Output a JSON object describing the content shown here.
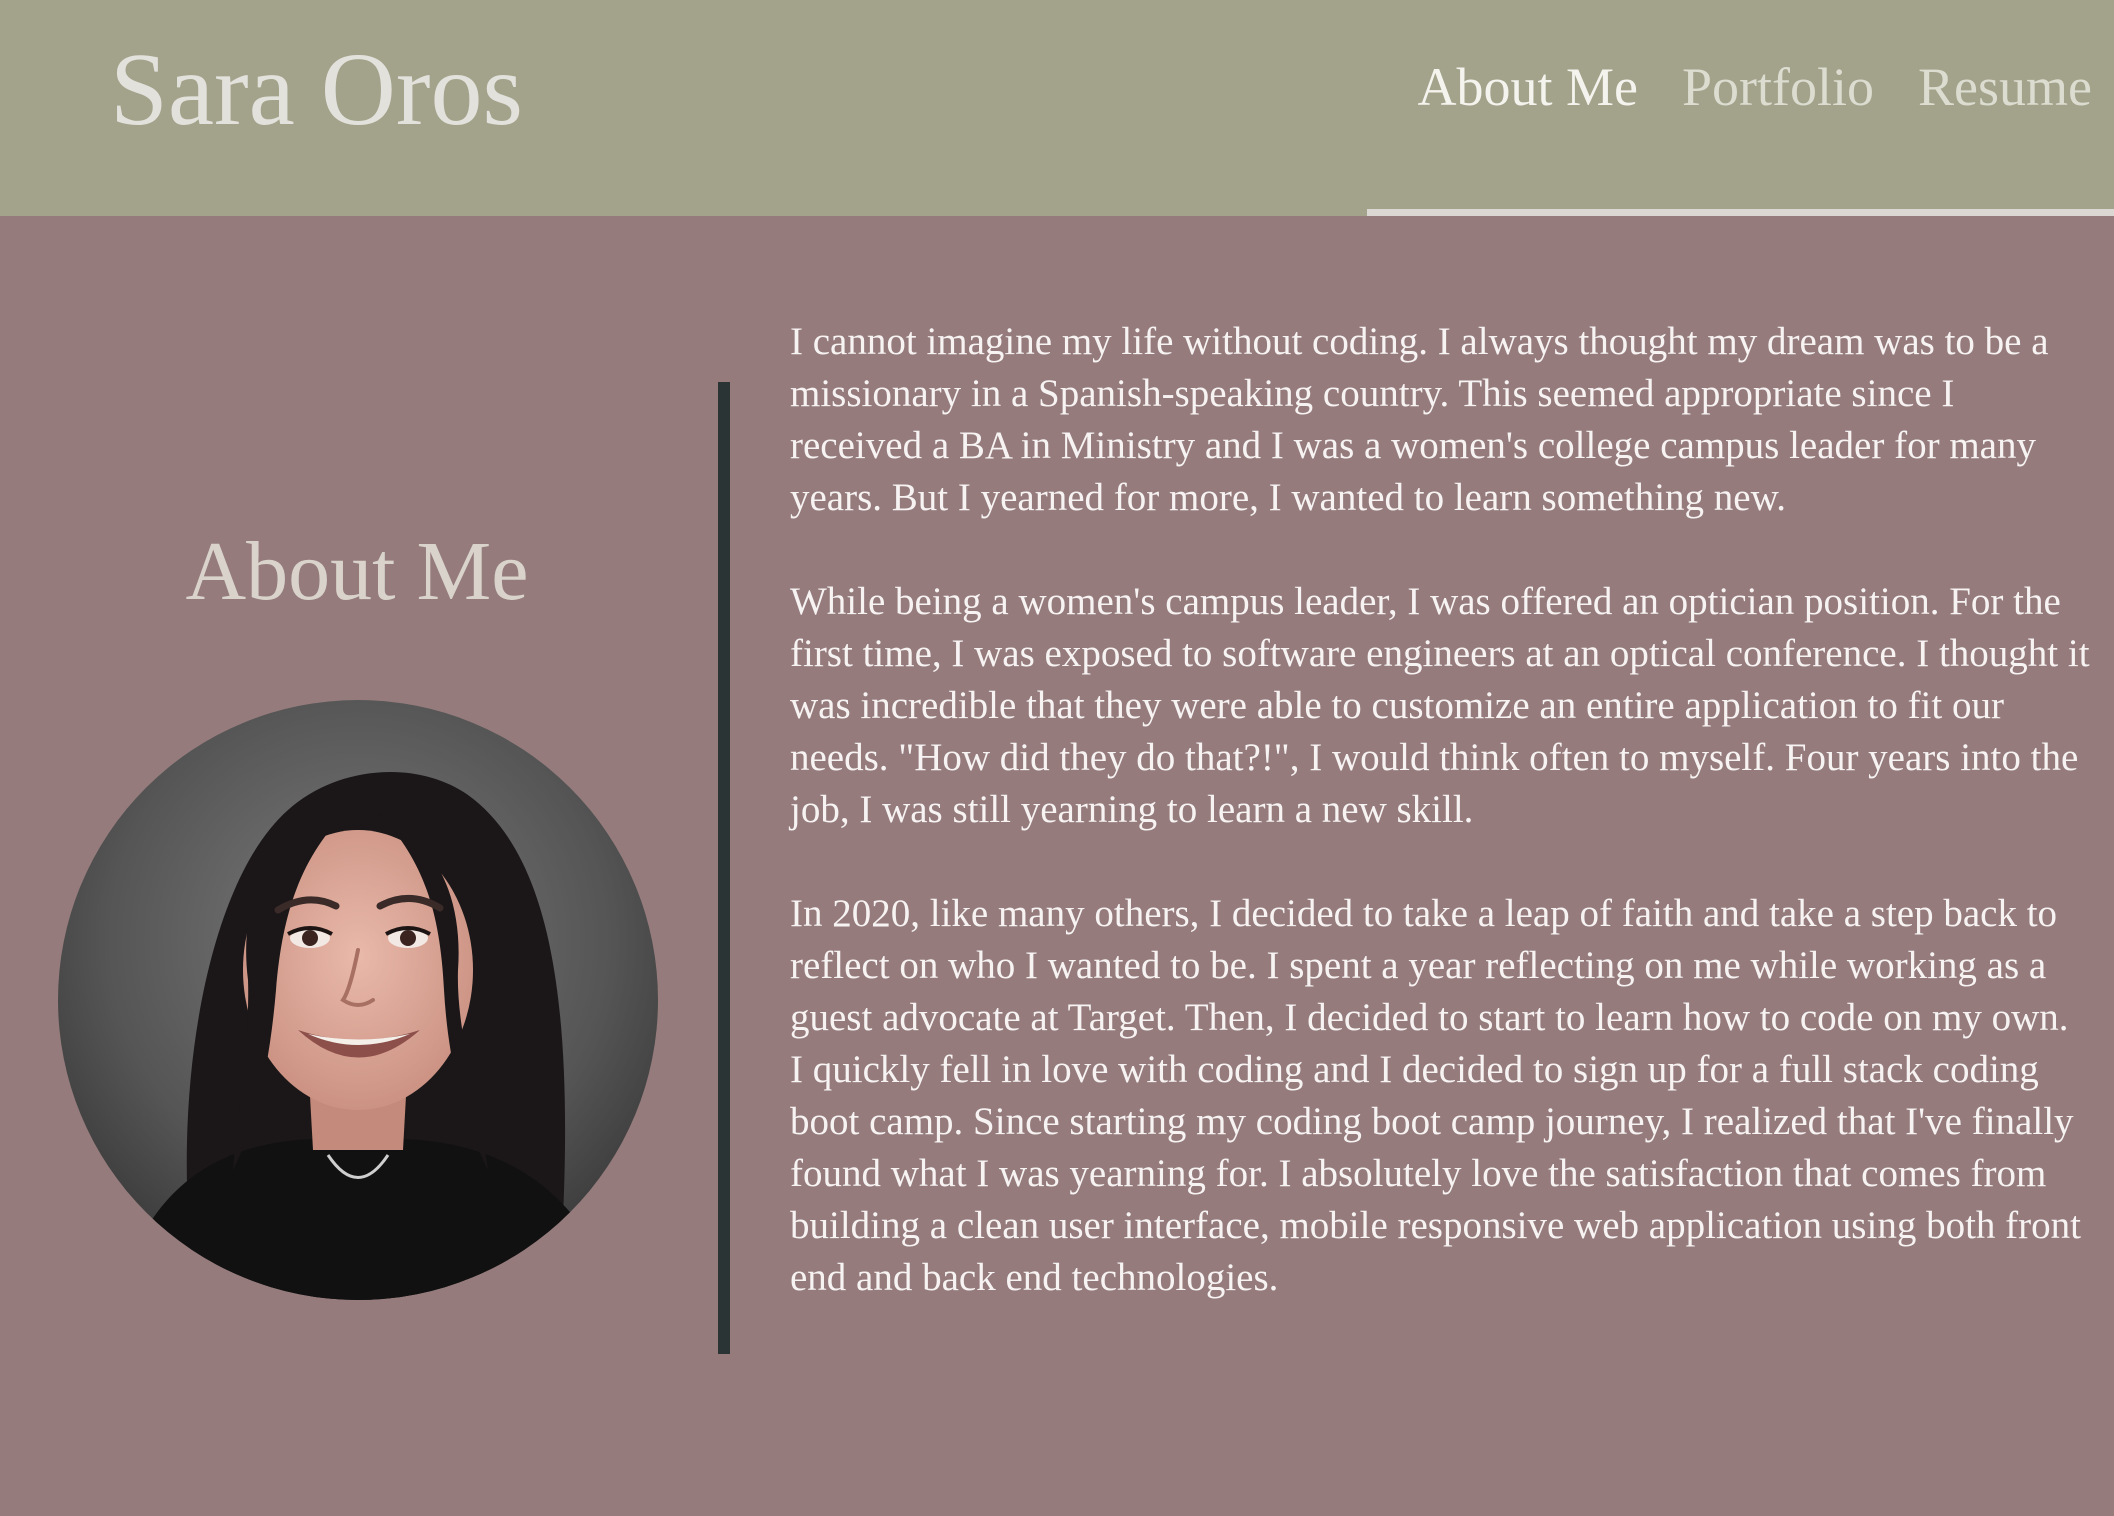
{
  "header": {
    "brand": "Sara Oros",
    "nav": [
      {
        "label": "About Me",
        "active": true
      },
      {
        "label": "Portfolio",
        "active": false
      },
      {
        "label": "Resume",
        "active": false
      }
    ]
  },
  "about": {
    "heading": "About Me",
    "portrait_alt": "Portrait photo of Sara Oros",
    "paragraphs": [
      "I cannot imagine my life without coding. I always thought my dream was to be a missionary in a Spanish-speaking country. This seemed appropriate since I received a BA in Ministry and I was a women's college campus leader for many years. But I yearned for more, I wanted to learn something new.",
      "While being a women's campus leader, I was offered an optician position. For the first time, I was exposed to software engineers at an optical conference. I thought it was incredible that they were able to customize an entire application to fit our needs. \"How did they do that?!\", I would think often to myself. Four years into the job, I was still yearning to learn a new skill.",
      "In 2020, like many others, I decided to take a leap of faith and take a step back to reflect on who I wanted to be. I spent a year reflecting on me while working as a guest advocate at Target. Then, I decided to start to learn how to code on my own. I quickly fell in love with coding and I decided to sign up for a full stack coding boot camp. Since starting my coding boot camp journey, I realized that I've finally found what I was yearning for. I absolutely love the satisfaction that comes from building a clean user interface, mobile responsive web application using both front end and back end technologies."
    ]
  },
  "colors": {
    "header_bg": "#a3a38b",
    "page_bg": "#957b7c",
    "divider": "#2a3434",
    "text": "#f7f3f3"
  }
}
